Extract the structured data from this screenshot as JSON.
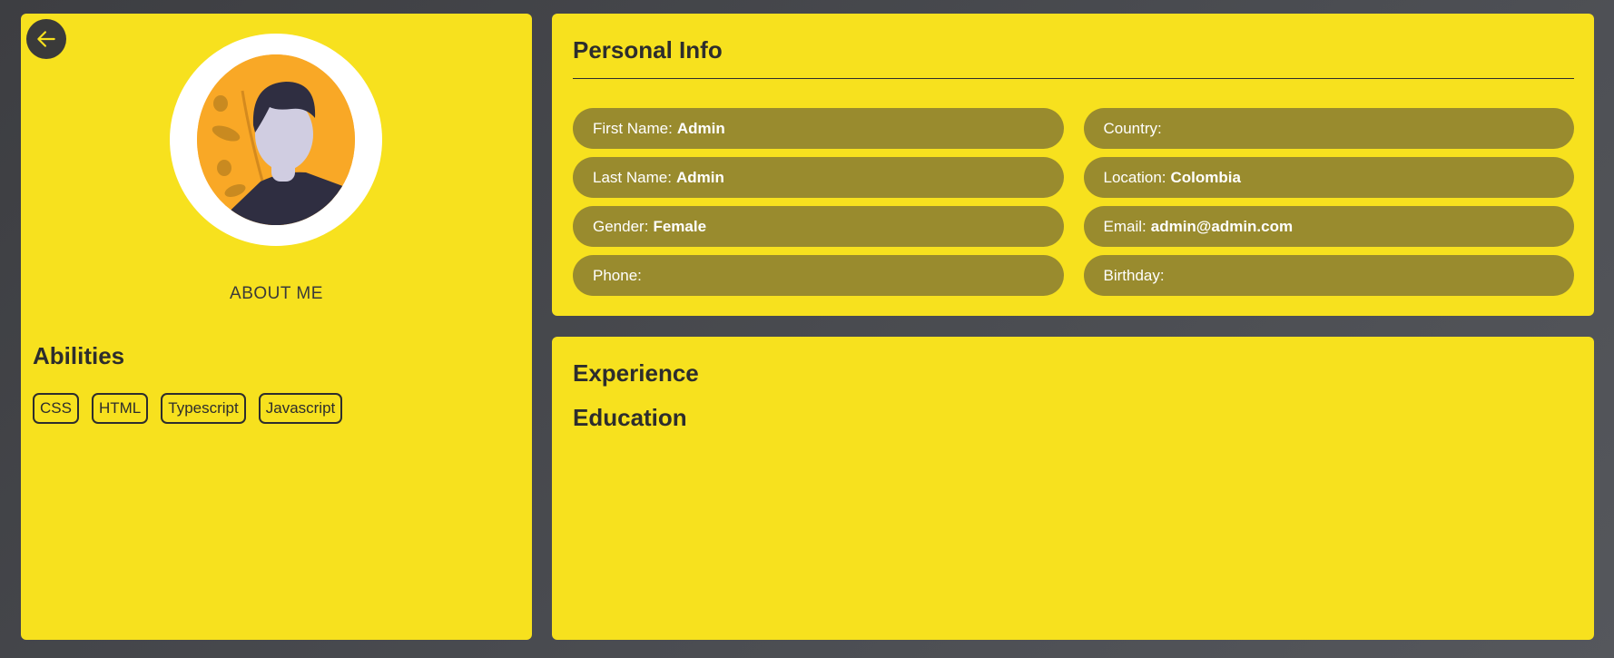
{
  "profile": {
    "about_label": "ABOUT ME",
    "abilities_title": "Abilities",
    "abilities": [
      "CSS",
      "HTML",
      "Typescript",
      "Javascript"
    ]
  },
  "personal_info": {
    "title": "Personal Info",
    "fields": [
      {
        "label": "First Name:",
        "value": "Admin"
      },
      {
        "label": "Country:",
        "value": ""
      },
      {
        "label": "Last Name:",
        "value": "Admin"
      },
      {
        "label": "Location:",
        "value": "Colombia"
      },
      {
        "label": "Gender:",
        "value": "Female"
      },
      {
        "label": "Email:",
        "value": "admin@admin.com"
      },
      {
        "label": "Phone:",
        "value": ""
      },
      {
        "label": "Birthday:",
        "value": ""
      }
    ]
  },
  "sections": {
    "experience_title": "Experience",
    "education_title": "Education"
  },
  "icons": {
    "back": "arrow-left-icon",
    "avatar": "user-avatar-illustration"
  },
  "colors": {
    "card": "#f7e11e",
    "field_bg": "#998b2e",
    "accent_dark": "#2d2d2d",
    "avatar_bg": "#f9a826"
  }
}
